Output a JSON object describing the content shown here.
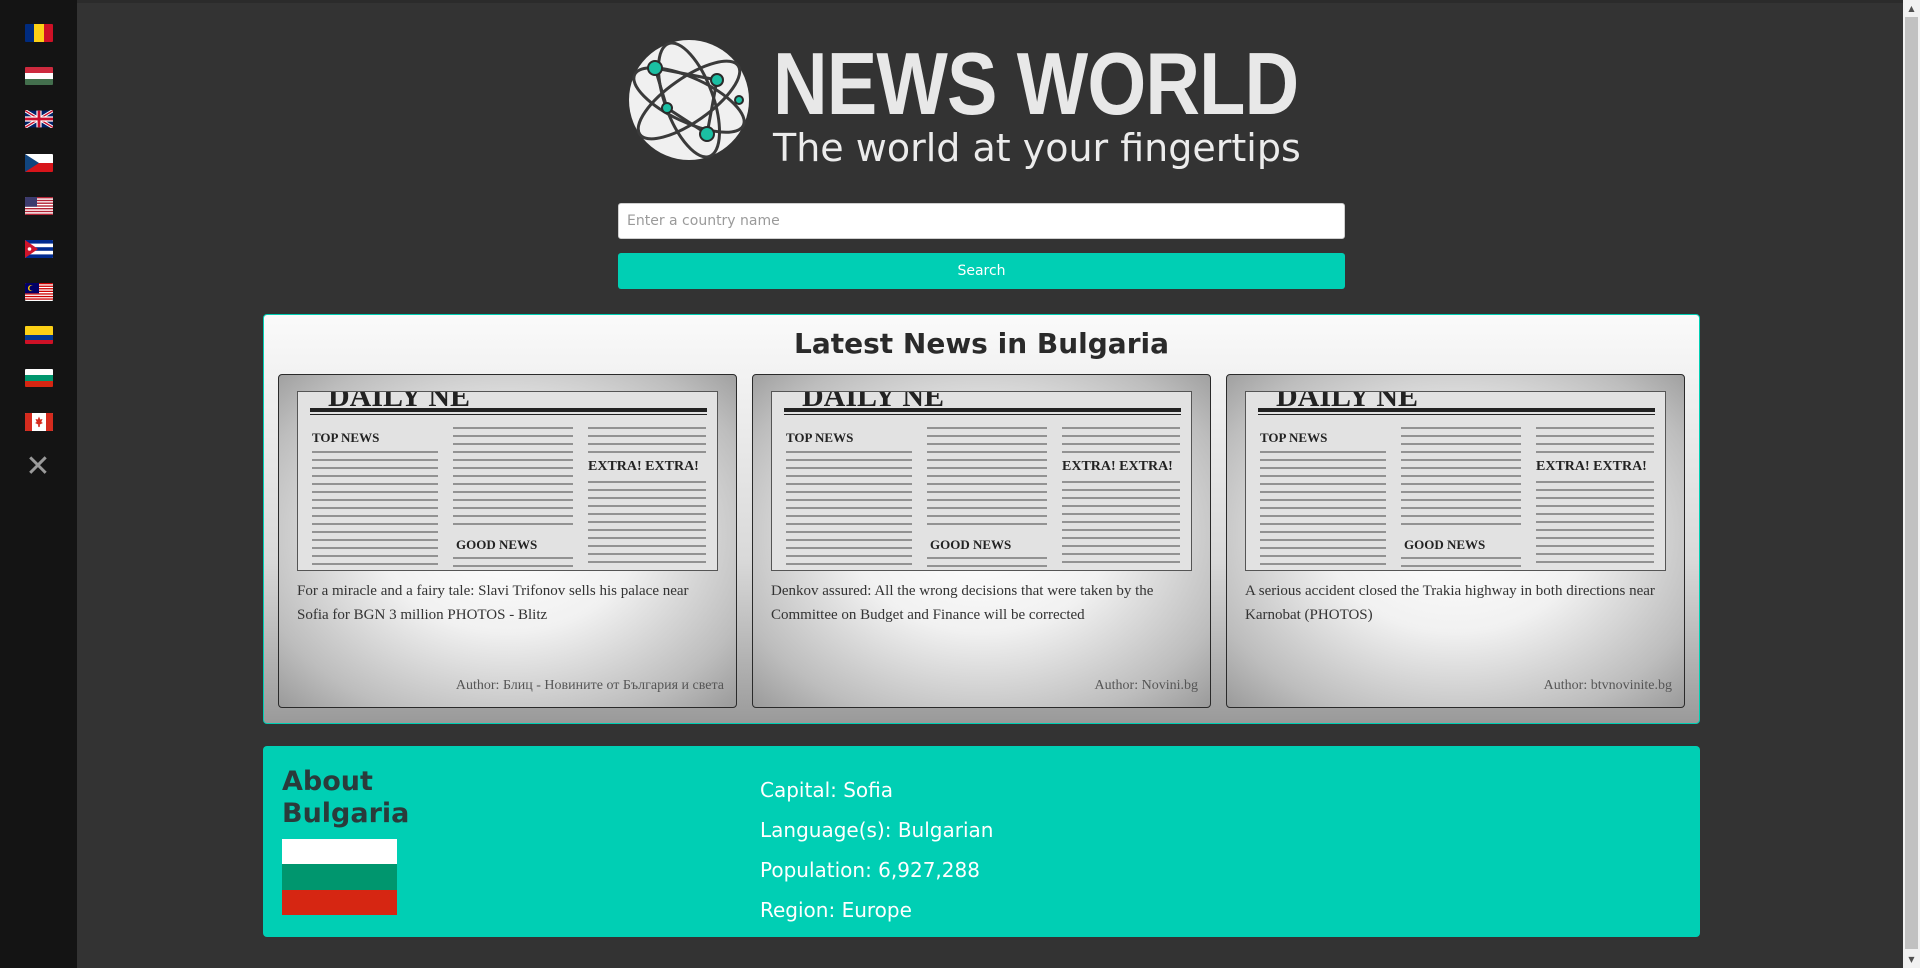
{
  "brand": {
    "title": "NEWS WORLD",
    "tagline": "The world at your fingertips"
  },
  "search": {
    "placeholder": "Enter a country name",
    "value": "",
    "button_label": "Search"
  },
  "sidebar": {
    "flags": [
      {
        "country": "Romania",
        "icon": "romania-flag-icon"
      },
      {
        "country": "Hungary",
        "icon": "hungary-flag-icon"
      },
      {
        "country": "United Kingdom",
        "icon": "uk-flag-icon"
      },
      {
        "country": "Czech Republic",
        "icon": "czech-flag-icon"
      },
      {
        "country": "United States",
        "icon": "usa-flag-icon"
      },
      {
        "country": "Cuba",
        "icon": "cuba-flag-icon"
      },
      {
        "country": "Malaysia",
        "icon": "malaysia-flag-icon"
      },
      {
        "country": "Colombia",
        "icon": "colombia-flag-icon"
      },
      {
        "country": "Bulgaria",
        "icon": "bulgaria-flag-icon"
      },
      {
        "country": "Canada",
        "icon": "canada-flag-icon"
      }
    ],
    "close_symbol": "✕"
  },
  "news": {
    "heading": "Latest News in Bulgaria",
    "articles": [
      {
        "headline": "For a miracle and a fairy tale: Slavi Trifonov sells his palace near Sofia for BGN 3 million PHOTOS - Blitz",
        "author": "Author: Блиц - Новините от България и света"
      },
      {
        "headline": "Denkov assured: All the wrong decisions that were taken by the Committee on Budget and Finance will be corrected",
        "author": "Author: Novini.bg"
      },
      {
        "headline": "A serious accident closed the Trakia highway in both directions near Karnobat (PHOTOS)",
        "author": "Author: btvnovinite.bg"
      }
    ],
    "image_text": {
      "top_news": "TOP NEWS",
      "extra": "EXTRA! EXTRA!",
      "good_news": "GOOD NEWS"
    }
  },
  "about": {
    "heading": "About Bulgaria",
    "facts": {
      "capital": "Capital: Sofia",
      "languages": "Language(s): Bulgarian",
      "population": "Population: 6,927,288",
      "region": "Region: Europe"
    },
    "flag_colors": [
      "#ffffff",
      "#00966e",
      "#d62612"
    ]
  },
  "colors": {
    "accent": "#00cfb4",
    "background": "#333333",
    "sidebar": "#141414"
  }
}
